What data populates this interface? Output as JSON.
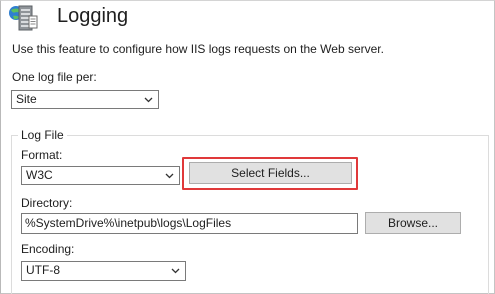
{
  "header": {
    "title": "Logging",
    "logo_icon": "iis-logging-server-icon"
  },
  "description": "Use this feature to configure how IIS logs requests on the Web server.",
  "one_log_file": {
    "label": "One log file per:",
    "value": "Site"
  },
  "log_file": {
    "group_label": "Log File",
    "format": {
      "label": "Format:",
      "value": "W3C"
    },
    "select_fields_label": "Select Fields...",
    "directory": {
      "label": "Directory:",
      "value": "%SystemDrive%\\inetpub\\logs\\LogFiles"
    },
    "browse_label": "Browse...",
    "encoding": {
      "label": "Encoding:",
      "value": "UTF-8"
    }
  },
  "colors": {
    "highlight": "#e0393a",
    "button_bg": "#e1e1e1"
  }
}
